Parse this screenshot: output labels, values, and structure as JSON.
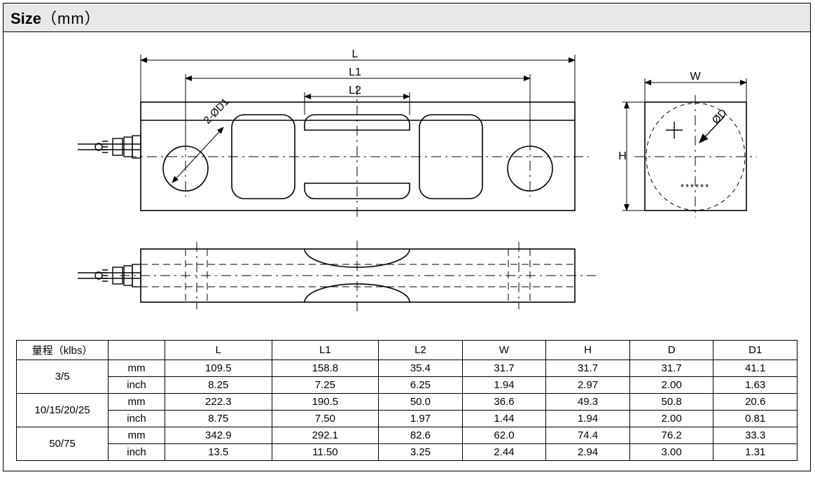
{
  "title": {
    "bold": "Size",
    "rest": "（mm）"
  },
  "diagram": {
    "labels": {
      "L": "L",
      "L1": "L1",
      "L2": "L2",
      "W": "W",
      "H": "H",
      "hole": "2-ØD1",
      "diaD": "ØD",
      "stars": "******"
    }
  },
  "table": {
    "headers": [
      "量程（klbs）",
      "",
      "L",
      "L1",
      "L2",
      "W",
      "H",
      "D",
      "D1"
    ],
    "rows": [
      {
        "range": "3/5",
        "mm": [
          "mm",
          "109.5",
          "158.8",
          "35.4",
          "31.7",
          "31.7",
          "31.7",
          "41.1"
        ],
        "inch": [
          "inch",
          "8.25",
          "7.25",
          "6.25",
          "1.94",
          "2.97",
          "2.00",
          "1.63"
        ]
      },
      {
        "range": "10/15/20/25",
        "mm": [
          "mm",
          "222.3",
          "190.5",
          "50.0",
          "36.6",
          "49.3",
          "50.8",
          "20.6"
        ],
        "inch": [
          "inch",
          "8.75",
          "7.50",
          "1.97",
          "1.44",
          "1.94",
          "2.00",
          "0.81"
        ]
      },
      {
        "range": "50/75",
        "mm": [
          "mm",
          "342.9",
          "292.1",
          "82.6",
          "62.0",
          "74.4",
          "76.2",
          "33.3"
        ],
        "inch": [
          "inch",
          "13.5",
          "11.50",
          "3.25",
          "2.44",
          "2.94",
          "3.00",
          "1.31"
        ]
      }
    ]
  }
}
